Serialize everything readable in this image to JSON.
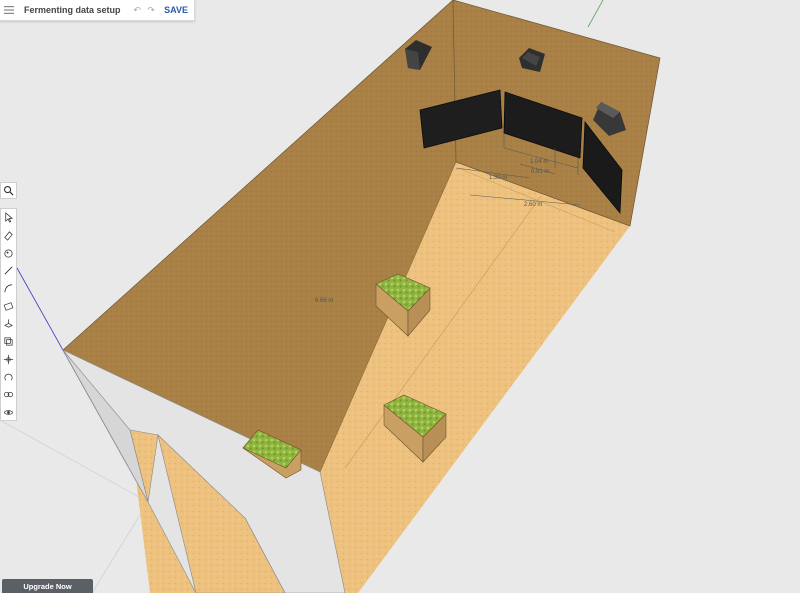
{
  "app": {
    "document_title": "Fermenting data setup",
    "save_label": "SAVE"
  },
  "scene": {
    "dimensions": {
      "d1": "1.04 m",
      "d2": "0.91 m",
      "d3": "1.30 m",
      "d4": "2.60 m",
      "d5": "6.66 m"
    }
  },
  "toolbar": {
    "tools": [
      "search",
      "select",
      "eraser",
      "paint",
      "pencil",
      "arc",
      "rectangle",
      "push-pull",
      "offset",
      "move",
      "rotate",
      "tape-measure",
      "orbit"
    ]
  },
  "footer": {
    "upgrade_label": "Upgrade Now"
  },
  "colors": {
    "wall": "#a98146",
    "floor": "#eec27e",
    "exterior": "#e4e4e4",
    "crate": "#d2aa6c",
    "plants": "#9ac148"
  }
}
